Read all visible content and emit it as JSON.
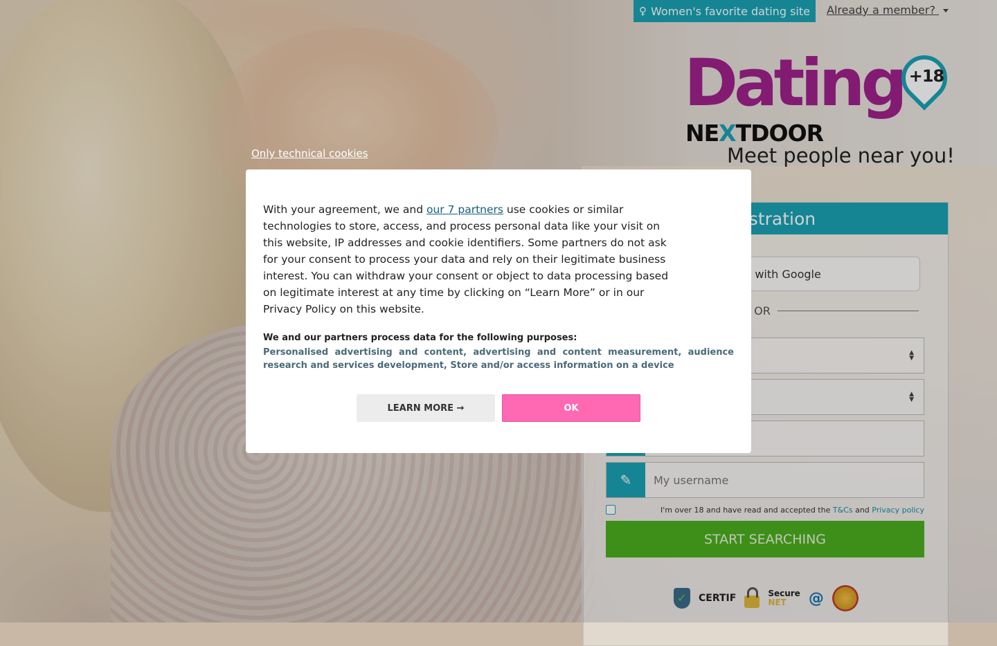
{
  "header": {
    "badge_label": "Women's favorite dating site",
    "member_label": "Already a member? "
  },
  "logo": {
    "word": "Dating",
    "sub_prefix": "NE",
    "sub_x": "X",
    "sub_suffix": "TDOOR",
    "age_badge": "+18"
  },
  "tagline": "Meet people near you!",
  "registration": {
    "title": "registration",
    "google_label": "nect with Google",
    "or_label": "OR",
    "username_placeholder": "My username",
    "terms_prefix": "I'm over 18 and have read and accepted the ",
    "terms_link": "T&Cs",
    "terms_and": " and ",
    "privacy_link": "Privacy policy",
    "start_label": "START SEARCHING",
    "trust": {
      "certif": "CERTIF",
      "secure_top": "Secure",
      "secure_bottom": "NET"
    }
  },
  "cookie": {
    "only_technical": "Only technical cookies",
    "para_before": "With your agreement, we and ",
    "partners_link": "our 7 partners",
    "para_after": " use cookies or similar technologies to store, access, and process personal data like your visit on this website, IP addresses and cookie identifiers. Some partners do not ask for your consent to process your data and rely on their legitimate business interest. You can withdraw your consent or object to data processing based on legitimate interest at any time by clicking on “Learn More” or in our Privacy Policy on this website.",
    "purposes_heading": "We and our partners process data for the following purposes:",
    "purposes_list": "Personalised advertising and content, advertising and content measurement, audience research and services development, Store and/or access information on a device",
    "learn_more_label": "LEARN MORE →",
    "ok_label": "OK"
  },
  "colors": {
    "teal": "#1aa3b5",
    "brand_purple": "#a0218c",
    "start_green": "#4caf1f",
    "ok_pink": "#ff69b4"
  }
}
